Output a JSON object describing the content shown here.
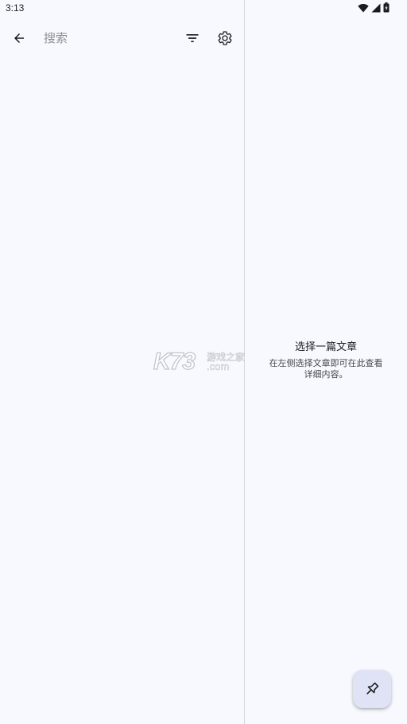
{
  "status_bar": {
    "time": "3:13",
    "icons": [
      "wifi-icon",
      "cellular-signal-icon",
      "battery-charging-icon"
    ]
  },
  "search": {
    "placeholder": "搜索",
    "value": ""
  },
  "toolbar": {
    "icons": [
      "back-arrow-icon",
      "filter-icon",
      "gear-icon"
    ]
  },
  "watermark": {
    "brand": "K73",
    "tagline": "游戏之家",
    "domain": ".com"
  },
  "detail": {
    "empty_title": "选择一篇文章",
    "empty_description": "在左侧选择文章即可在此查看详细内容。"
  },
  "fab": {
    "icon": "pin-icon"
  },
  "colors": {
    "background": "#f8f9fe",
    "divider": "#d8d9de",
    "fab_background": "#dfe3f5",
    "text_primary": "#1b1b1f",
    "text_secondary": "#45464f"
  }
}
